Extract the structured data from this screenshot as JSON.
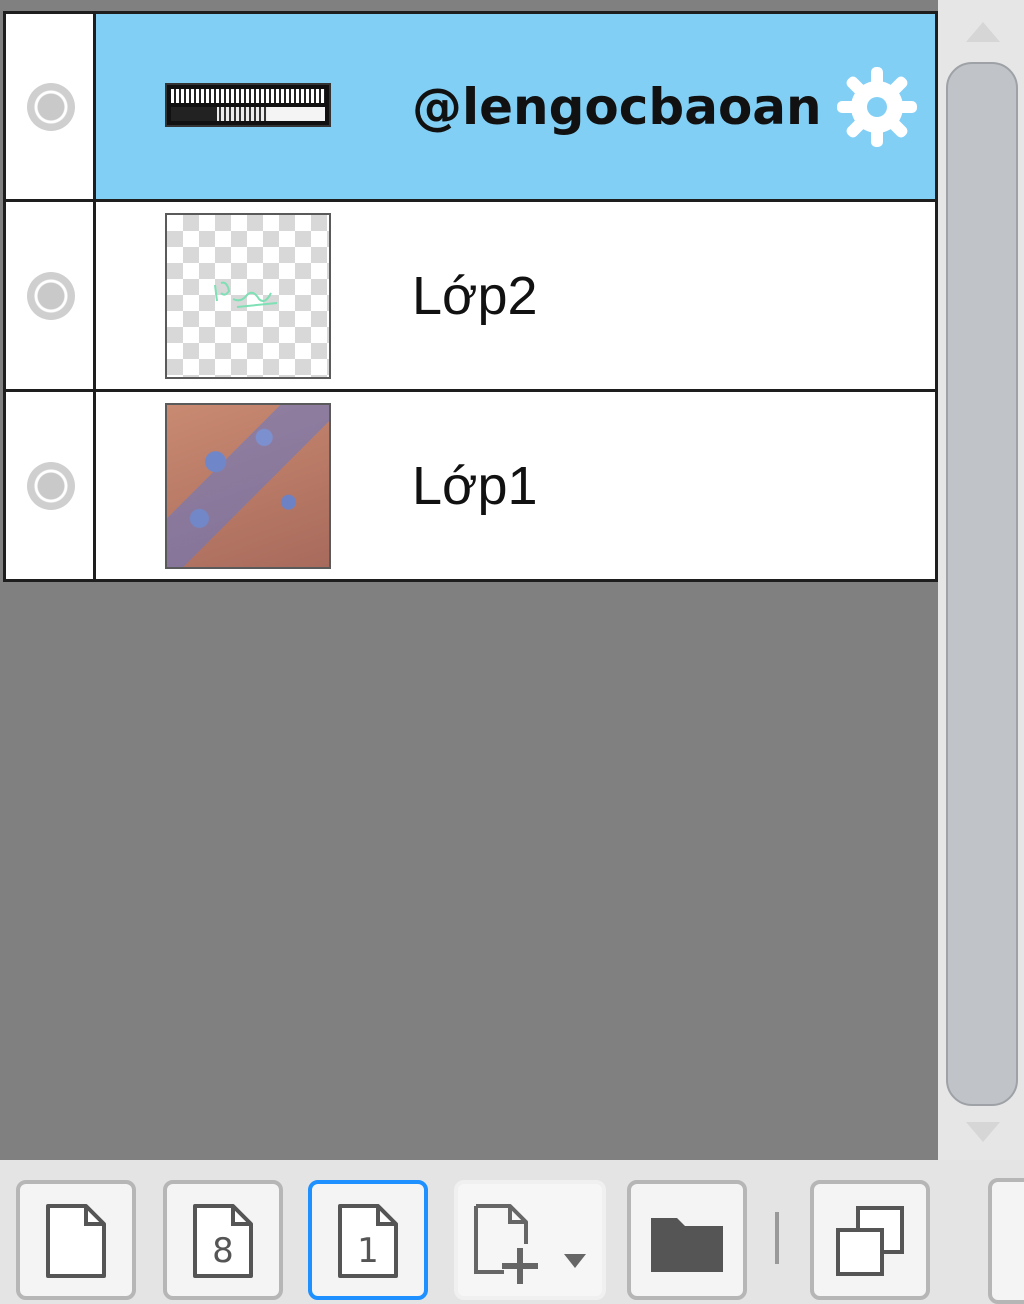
{
  "layers": [
    {
      "name": "@lengocbaoan",
      "type": "text",
      "selected": true
    },
    {
      "name": "Lớp2",
      "type": "raster",
      "selected": false
    },
    {
      "name": "Lớp1",
      "type": "raster",
      "selected": false
    }
  ],
  "colors": {
    "selected_row": "#82cff5",
    "active_button_border": "#1e90ff",
    "empty_area": "#808080"
  },
  "toolbar": {
    "buttons": [
      {
        "icon": "new-page-icon"
      },
      {
        "icon": "page-8-icon",
        "label": "8"
      },
      {
        "icon": "page-1-icon",
        "label": "1",
        "active": true
      },
      {
        "icon": "add-layer-dropdown-icon"
      },
      {
        "icon": "folder-icon"
      },
      {
        "icon": "duplicate-icon"
      }
    ]
  }
}
